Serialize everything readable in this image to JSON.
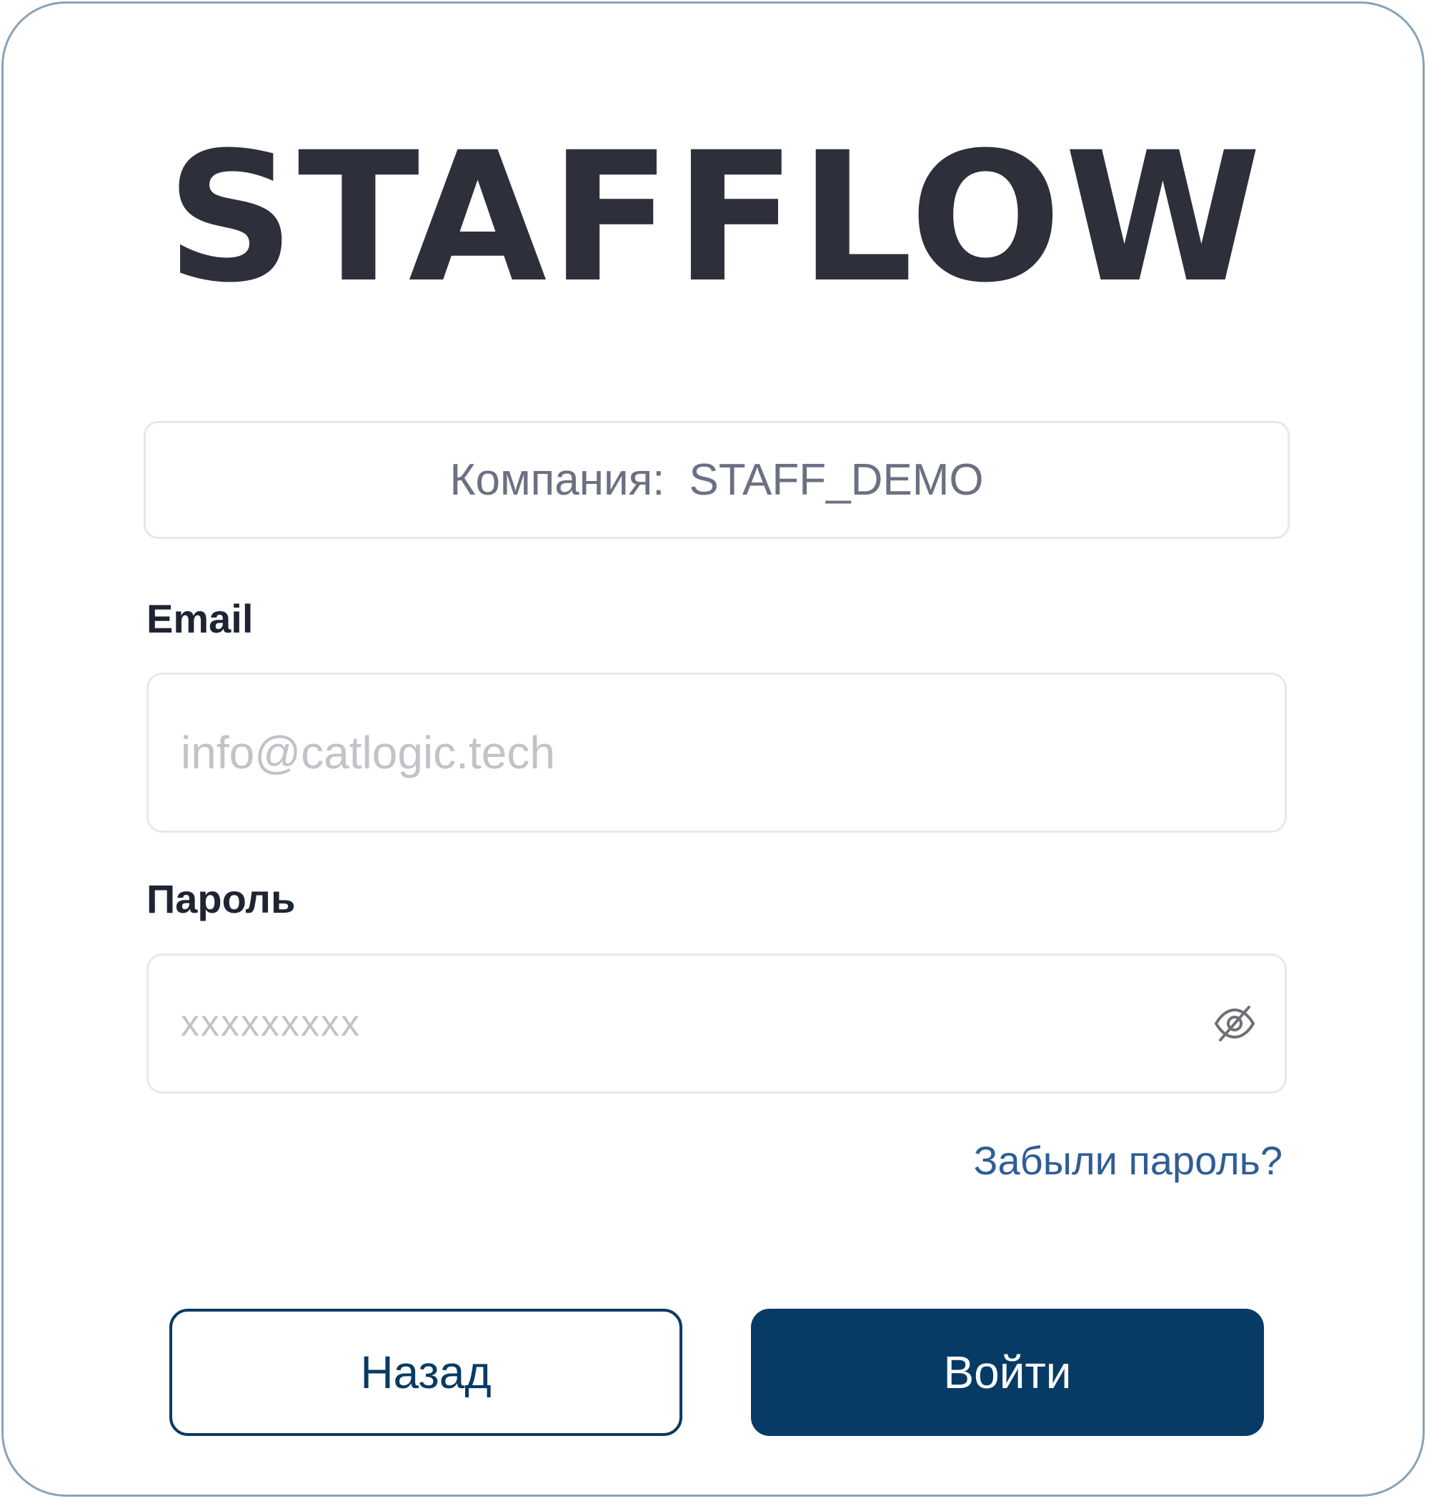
{
  "brand": {
    "logo_text": "STAFFLOW"
  },
  "company": {
    "label": "Компания:",
    "value": "STAFF_DEMO"
  },
  "email": {
    "label": "Email",
    "placeholder": "info@catlogic.tech",
    "value": ""
  },
  "password": {
    "label": "Пароль",
    "placeholder": "xxxxxxxxx",
    "value": "",
    "toggle_icon": "eye-off-icon"
  },
  "links": {
    "forgot_password": "Забыли пароль?"
  },
  "buttons": {
    "back_label": "Назад",
    "login_label": "Войти"
  },
  "colors": {
    "primary": "#073b66",
    "link": "#2f5d96",
    "card_border": "#8aa2b8",
    "logo": "#2d2f3b"
  }
}
